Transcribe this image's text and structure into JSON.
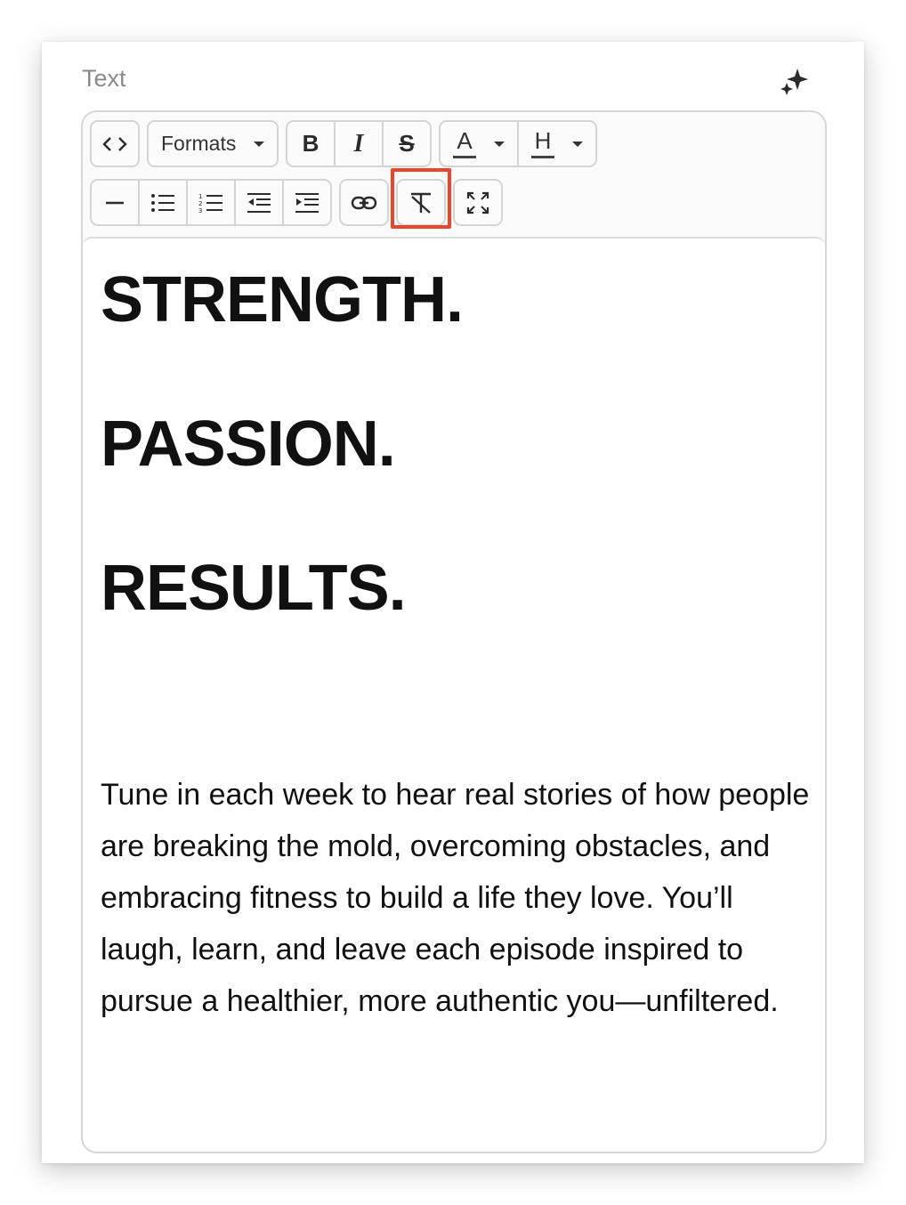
{
  "field": {
    "label": "Text",
    "ai_icon": "sparkles-icon"
  },
  "toolbar": {
    "row1": {
      "source_code_icon": "code-brackets-icon",
      "formats_label": "Formats",
      "bold_label": "B",
      "italic_label": "I",
      "strike_label": "S",
      "text_color_label": "A",
      "highlight_color_label": "H"
    },
    "row2": {
      "icons": [
        "horizontal-rule-icon",
        "bullet-list-icon",
        "numbered-list-icon",
        "outdent-icon",
        "indent-icon",
        "link-icon",
        "clear-formatting-icon",
        "fullscreen-icon"
      ]
    },
    "highlighted_button": "clear-formatting",
    "highlight_color": "#e8462e"
  },
  "content": {
    "headlines": [
      "STRENGTH.",
      "PASSION.",
      "RESULTS."
    ],
    "paragraph": "Tune in each week to hear real stories of how people are breaking the mold, overcoming obstacles, and embracing fitness to build a life they love. You’ll laugh, learn, and leave each episode inspired to pursue a healthier, more authentic you—unfiltered."
  }
}
